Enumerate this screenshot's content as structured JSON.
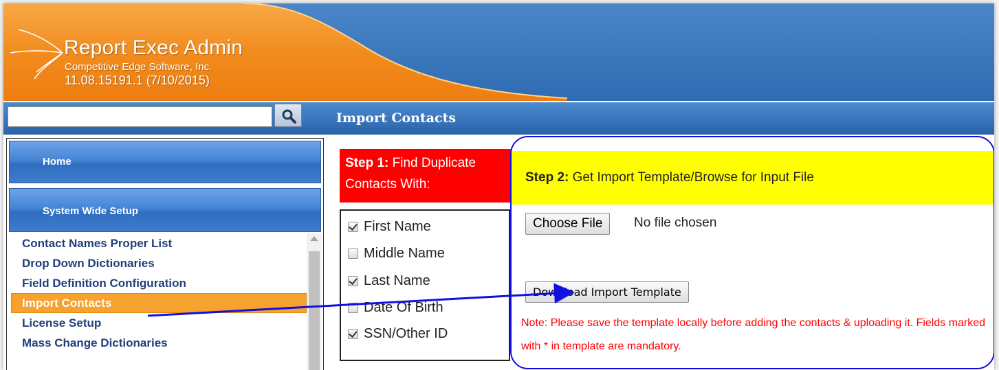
{
  "header": {
    "app_title": "Report Exec Admin",
    "company": "Competitive Edge Software, Inc.",
    "version": "11.08.15191.1 (7/10/2015)"
  },
  "search": {
    "placeholder": "",
    "value": "",
    "icon": "search-icon"
  },
  "page_title": "Import Contacts",
  "sidebar": {
    "home": "Home",
    "system_wide_setup": "System Wide Setup",
    "items": [
      {
        "label": "Contact Names Proper List",
        "active": false
      },
      {
        "label": "Drop Down Dictionaries",
        "active": false
      },
      {
        "label": "Field Definition Configuration",
        "active": false
      },
      {
        "label": "Import Contacts",
        "active": true
      },
      {
        "label": "License Setup",
        "active": false
      },
      {
        "label": "Mass Change Dictionaries",
        "active": false
      }
    ]
  },
  "step1": {
    "label_bold": "Step 1:",
    "label_rest": " Find Duplicate Contacts With:",
    "options": [
      {
        "label": "First Name",
        "checked": true
      },
      {
        "label": "Middle Name",
        "checked": false
      },
      {
        "label": "Last Name",
        "checked": true
      },
      {
        "label": "Date Of Birth",
        "checked": false
      },
      {
        "label": "SSN/Other ID",
        "checked": true
      }
    ]
  },
  "step2": {
    "label_bold": "Step 2:",
    "label_rest": " Get Import Template/Browse for Input File",
    "choose_file": "Choose File",
    "file_status": "No file chosen",
    "download_button": "Download Import Template",
    "note": "Note: Please save the template locally before adding the contacts & uploading it. Fields marked with * in template are mandatory."
  },
  "colors": {
    "header_orange": "#f28c1e",
    "header_blue": "#3b78c0",
    "active_item": "#f7a12e",
    "step1_bg": "#ff0000",
    "step2_bg": "#ffff00",
    "note_text": "#ff0000",
    "arrow": "#1010e0"
  }
}
